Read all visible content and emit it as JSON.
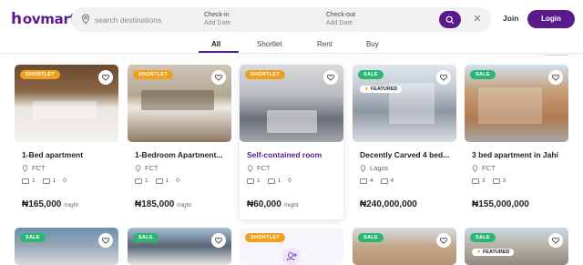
{
  "brand": {
    "logo_text": "ovmart",
    "logo_mark": "h"
  },
  "search": {
    "placeholder": "search destinations",
    "checkin_label": "Check-in",
    "checkin_value": "Add Date",
    "checkout_label": "Check-out",
    "checkout_value": "Add Date"
  },
  "nav": {
    "join_label": "Join",
    "login_label": "Login"
  },
  "tabs": [
    {
      "label": "All",
      "active": true
    },
    {
      "label": "Shortlet",
      "active": false
    },
    {
      "label": "Rent",
      "active": false
    },
    {
      "label": "Buy",
      "active": false
    }
  ],
  "listings": [
    {
      "badge": "SHORTLET",
      "title": "1-Bed apartment",
      "location": "FCT",
      "beds": "1",
      "baths": "1",
      "toilets": "0",
      "price": "₦165,000",
      "per": "/night"
    },
    {
      "badge": "SHORTLET",
      "title": "1-Bedroom Apartment...",
      "location": "FCT",
      "beds": "1",
      "baths": "1",
      "toilets": "0",
      "price": "₦185,000",
      "per": "/night"
    },
    {
      "badge": "SHORTLET",
      "title": "Self-contained room",
      "location": "FCT",
      "beds": "1",
      "baths": "1",
      "toilets": "0",
      "price": "₦60,000",
      "per": "/night"
    },
    {
      "badge": "SALE",
      "featured": "FEATURED",
      "title": "Decently Carved 4 bed...",
      "location": "Lagos",
      "beds": "4",
      "baths": "4",
      "price": "₦240,000,000"
    },
    {
      "badge": "SALE",
      "title": "3 bed apartment in Jahi",
      "location": "FCT",
      "beds": "3",
      "baths": "3",
      "price": "₦155,000,000"
    },
    {
      "badge": "SALE"
    },
    {
      "badge": "SALE"
    },
    {
      "badge": "SHORTLET"
    },
    {
      "badge": "SALE"
    },
    {
      "badge": "SALE",
      "featured": "FEATURED"
    }
  ],
  "colors": {
    "brand": "#5a1a8c",
    "shortlet": "#f0a01e",
    "sale": "#2bb673"
  }
}
